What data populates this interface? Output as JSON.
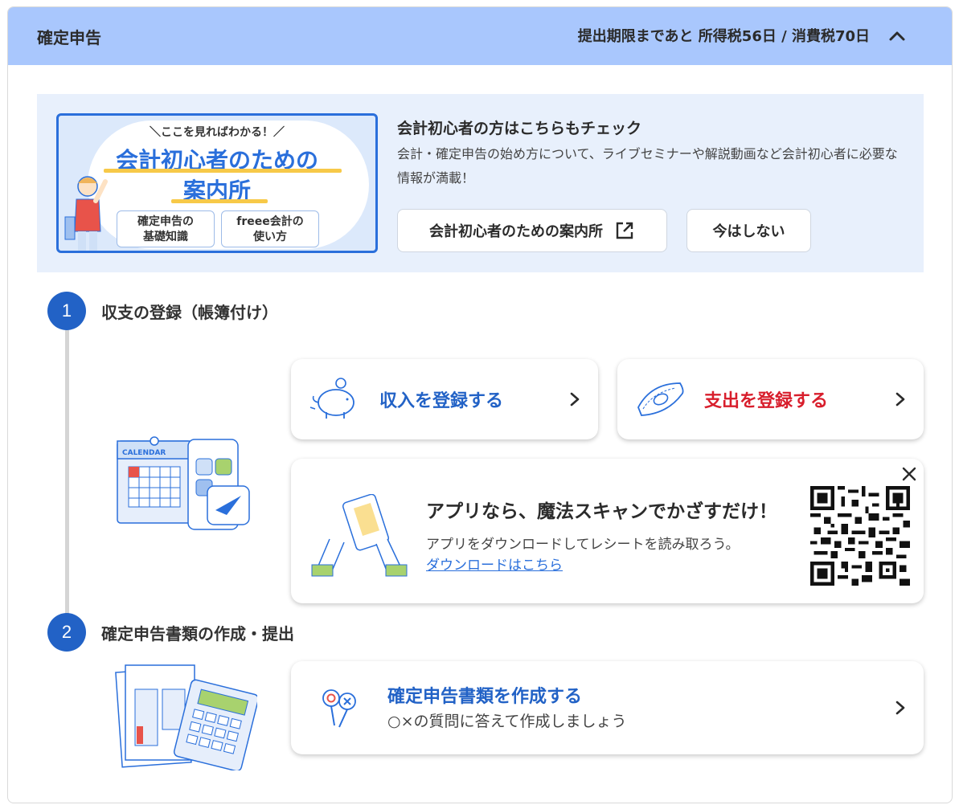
{
  "header": {
    "title": "確定申告",
    "deadline_text": "提出期限まであと 所得税56日 / 消費税70日",
    "collapse_icon": "chevron-up-icon"
  },
  "promo": {
    "banner": {
      "kicker": "＼ここを見ればわかる！／",
      "title_line1": "会計初心者のための",
      "title_line2": "案内所",
      "chip1": "確定申告の\n基礎知識",
      "chip2": "freee会計の\n使い方"
    },
    "heading": "会計初心者の方はこちらもチェック",
    "description": "会計・確定申告の始め方について、ライブセミナーや解説動画など会計初心者に必要な情報が満載！",
    "primary_button_label": "会計初心者のための案内所",
    "primary_button_icon": "external-link-icon",
    "dismiss_button_label": "今はしない"
  },
  "steps": [
    {
      "number": "1",
      "title": "収支の登録（帳簿付け）",
      "income_card": {
        "label": "収入を登録する",
        "icon": "piggy-bank-icon",
        "color": "#2262c6"
      },
      "expense_card": {
        "label": "支出を登録する",
        "icon": "money-bill-icon",
        "color": "#d81e2c"
      },
      "app_card": {
        "title": "アプリなら、魔法スキャンでかざすだけ！",
        "description": "アプリをダウンロードしてレシートを読み取ろう。",
        "link_label": "ダウンロードはこちら",
        "close_icon": "close-icon"
      }
    },
    {
      "number": "2",
      "title": "確定申告書類の作成・提出",
      "doc_card": {
        "title": "確定申告書類を作成する",
        "subtitle": "○×の質問に答えて作成しましょう",
        "icon": "ox-sign-icon"
      }
    }
  ],
  "colors": {
    "accent": "#2262c6",
    "header_bg": "#a9c7fd",
    "promo_bg": "#e8f0fc",
    "expense": "#d81e2c"
  }
}
